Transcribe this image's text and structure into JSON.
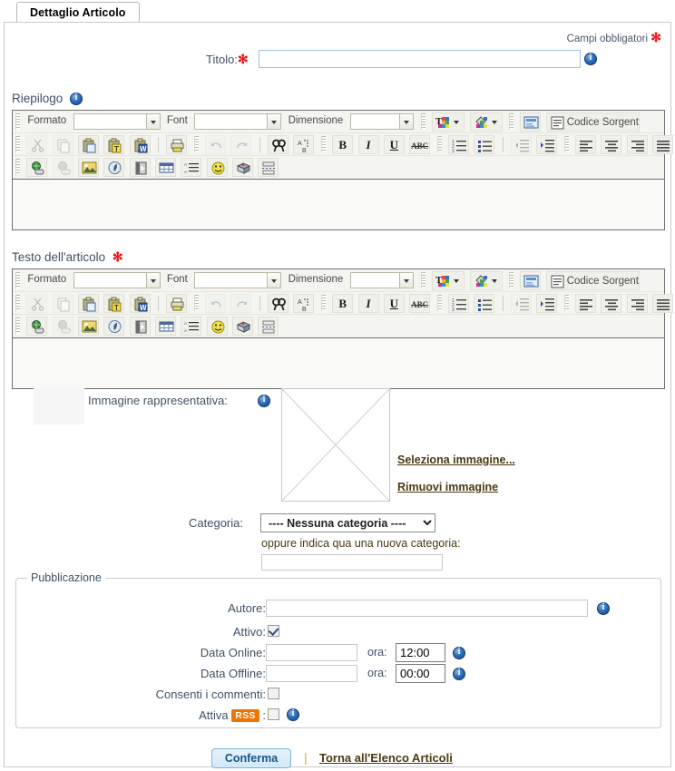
{
  "tab": {
    "label": "Dettaglio Articolo"
  },
  "required_note": {
    "text": "Campi obbligatori",
    "marker": "✻"
  },
  "title_field": {
    "label": "Titolo:",
    "marker": "✻",
    "value": "",
    "placeholder": ""
  },
  "sections": {
    "riepilogo": {
      "label": "Riepilogo"
    },
    "testo": {
      "label": "Testo dell'articolo",
      "marker": "✻"
    }
  },
  "editor": {
    "combo_labels": {
      "formato": "Formato",
      "font": "Font",
      "dimensione": "Dimensione"
    },
    "combo_values": {
      "formato": "",
      "font": "",
      "dimensione": ""
    },
    "source_button": "Codice Sorgente",
    "content": ""
  },
  "image_section": {
    "label": "Immagine rappresentativa:",
    "select_link": "Seleziona immagine...",
    "remove_link": "Rimuovi immagine"
  },
  "category": {
    "label": "Categoria:",
    "selected": "---- Nessuna categoria ----",
    "options": [
      "---- Nessuna categoria ----"
    ],
    "new_hint": "oppure indica qua una nuova categoria:",
    "new_value": ""
  },
  "publication": {
    "legend": "Pubblicazione",
    "author": {
      "label": "Autore:",
      "value": ""
    },
    "active": {
      "label": "Attivo:",
      "checked": true
    },
    "date_online": {
      "label": "Data Online:",
      "value": "",
      "ora_label": "ora:",
      "ora_value": "12:00"
    },
    "date_offline": {
      "label": "Data Offline:",
      "value": "",
      "ora_label": "ora:",
      "ora_value": "00:00"
    },
    "comments": {
      "label": "Consenti i commenti:",
      "checked": false
    },
    "rss": {
      "label_before": "Attiva",
      "badge": "RSS",
      "label_after": ":",
      "checked": false
    }
  },
  "footer": {
    "confirm": "Conferma",
    "separator": "|",
    "back_link": "Torna all'Elenco Articoli"
  },
  "colors": {
    "accent_blue": "#17558c",
    "label_blue": "#3f5166",
    "link_brown": "#4b3a12",
    "required_red": "#ee1111",
    "rss_orange": "#ee7302"
  }
}
